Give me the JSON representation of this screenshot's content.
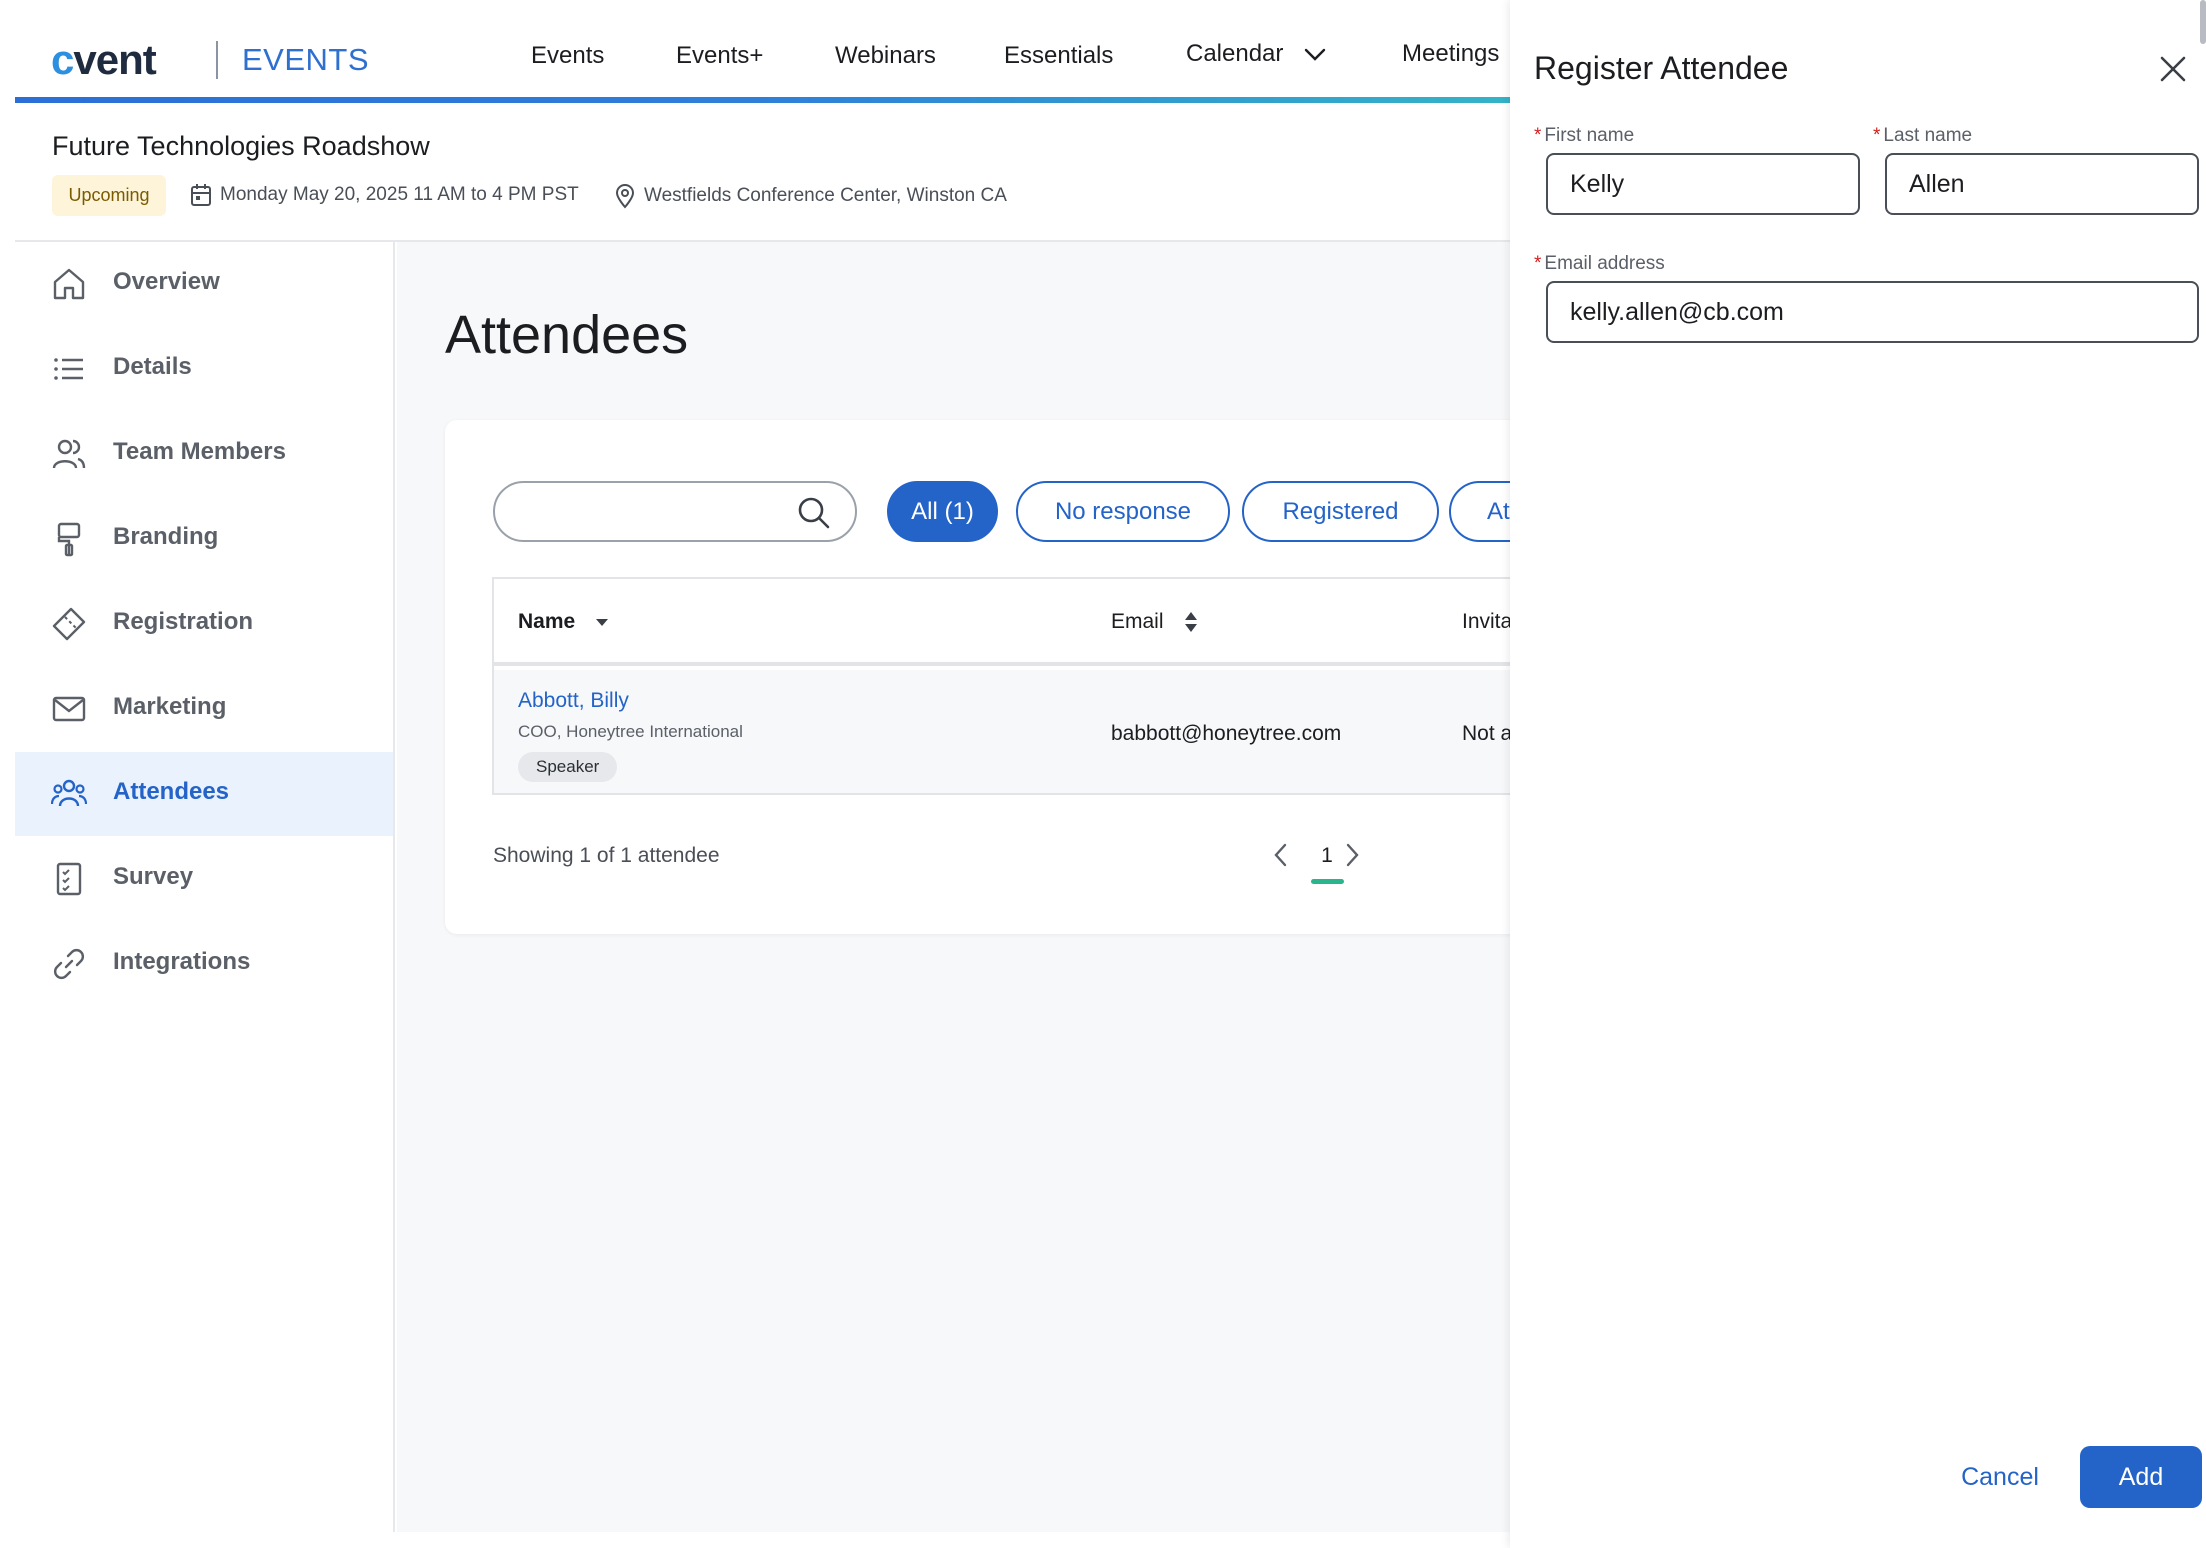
{
  "brand": {
    "logo_prefix": "c",
    "logo_rest": "vent",
    "product": "EVENTS"
  },
  "topnav": {
    "items": [
      "Events",
      "Events+",
      "Webinars",
      "Essentials",
      "Calendar",
      "Meetings"
    ]
  },
  "event": {
    "title": "Future Technologies Roadshow",
    "status": "Upcoming",
    "date": "Monday May 20, 2025 11 AM to 4 PM PST",
    "location": "Westfields Conference Center, Winston CA"
  },
  "sidebar": {
    "items": [
      {
        "label": "Overview",
        "icon": "home-icon"
      },
      {
        "label": "Details",
        "icon": "list-icon"
      },
      {
        "label": "Team Members",
        "icon": "team-icon"
      },
      {
        "label": "Branding",
        "icon": "paint-roller-icon"
      },
      {
        "label": "Registration",
        "icon": "ticket-icon"
      },
      {
        "label": "Marketing",
        "icon": "envelope-icon"
      },
      {
        "label": "Attendees",
        "icon": "attendees-icon",
        "active": true
      },
      {
        "label": "Survey",
        "icon": "survey-icon"
      },
      {
        "label": "Integrations",
        "icon": "link-icon"
      }
    ]
  },
  "main": {
    "title": "Attendees",
    "search": {
      "placeholder": "",
      "value": ""
    },
    "filters": [
      "All (1)",
      "No response",
      "Registered",
      "Attended"
    ],
    "table": {
      "columns": [
        "Name",
        "Email",
        "Invita"
      ],
      "rows": [
        {
          "name": "Abbott, Billy",
          "subtitle": "COO, Honeytree International",
          "tag": "Speaker",
          "email": "babbott@honeytree.com",
          "invitation": "Not a"
        }
      ]
    },
    "footer": {
      "showing": "Showing 1 of 1 attendee",
      "page": "1"
    }
  },
  "drawer": {
    "title": "Register Attendee",
    "fields": {
      "first_name": {
        "label": "First name",
        "value": "Kelly"
      },
      "last_name": {
        "label": "Last name",
        "value": "Allen"
      },
      "email": {
        "label": "Email address",
        "value": "kelly.allen@cb.com"
      }
    },
    "required_marker": "*",
    "cancel_label": "Cancel",
    "add_label": "Add"
  },
  "colors": {
    "primary": "#2463c8",
    "accent_teal": "#2bb58c",
    "badge_bg": "#fdf4d9",
    "required": "#d21f1f"
  }
}
